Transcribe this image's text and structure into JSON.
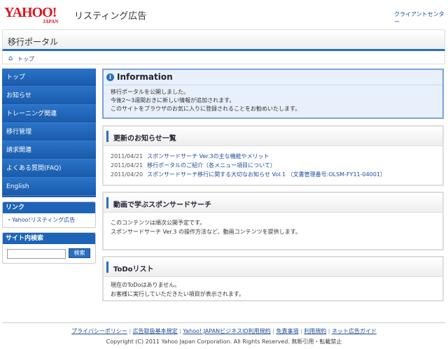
{
  "header": {
    "logo_text": "YAHOO!",
    "logo_sub": "JAPAN",
    "product": "リスティング広告",
    "client_center": "クライアントセンター"
  },
  "portal": {
    "title": "移行ポータル"
  },
  "breadcrumb": {
    "home": "トップ"
  },
  "nav": {
    "items": [
      "トップ",
      "お知らせ",
      "トレーニング関連",
      "移行管理",
      "請求関連",
      "よくある質問(FAQ)",
      "English"
    ]
  },
  "links_box": {
    "title": "リンク",
    "items": [
      "・Yahoo!リスティング広告"
    ]
  },
  "search_box": {
    "title": "サイト内検索",
    "input_value": "",
    "button": "検索"
  },
  "info": {
    "title": "Information",
    "lines": [
      "移行ポータルを公開しました。",
      "今後2～3週間おきに新しい情報が追加されます。",
      "このサイトをブラウザのお気に入りに登録されることをお勧めいたします。"
    ]
  },
  "updates": {
    "title": "更新のお知らせ一覧",
    "items": [
      {
        "date": "2011/04/21",
        "title": "スポンサードサーチ Ver.3の主な機能やメリット"
      },
      {
        "date": "2011/04/21",
        "title": "移行ポータルのご紹介（各メニュー項目について）"
      },
      {
        "date": "2011/04/20",
        "title": "スポンサードサーチ移行に関する大切なお知らせ Vol.1 （文書管理番号:OLSM-FY11-04001）"
      }
    ]
  },
  "video": {
    "title": "動画で学ぶスポンサードサーチ",
    "lines": [
      "このコンテンツは順次公開予定です。",
      "スポンサードサーチ Ver.3 の操作方法など、動画コンテンツを提供します。"
    ]
  },
  "todo": {
    "title": "ToDoリスト",
    "lines": [
      "現在のToDoはありません。",
      "お客様に実行していただきたい項目が表示されます。"
    ]
  },
  "footer": {
    "links": [
      "プライバシーポリシー",
      "広告取扱基本規定",
      "Yahoo! JAPANビジネスID利用規約",
      "免責事項",
      "利用規約",
      "ネット広告ガイド"
    ],
    "copyright": "Copyright (C) 2011 Yahoo Japan Corporation. All Rights Reserved. 無断引用・転載禁止"
  }
}
